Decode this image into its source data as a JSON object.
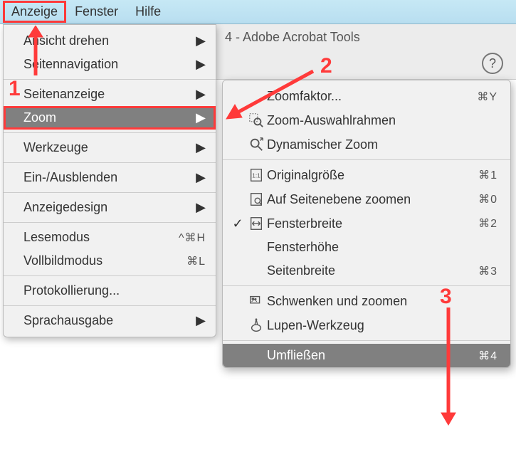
{
  "menubar": {
    "anzeige": "Anzeige",
    "fenster": "Fenster",
    "hilfe": "Hilfe"
  },
  "dropdown": {
    "ansicht_drehen": "Ansicht drehen",
    "seitennavigation": "Seitennavigation",
    "seitenanzeige": "Seitenanzeige",
    "zoom": "Zoom",
    "werkzeuge": "Werkzeuge",
    "ein_ausblenden": "Ein-/Ausblenden",
    "anzeigedesign": "Anzeigedesign",
    "lesemodus": "Lesemodus",
    "lesemodus_sc": "^⌘H",
    "vollbildmodus": "Vollbildmodus",
    "vollbildmodus_sc": "⌘L",
    "protokollierung": "Protokollierung...",
    "sprachausgabe": "Sprachausgabe"
  },
  "toolbar": {
    "title": "4 - Adobe Acrobat Tools",
    "help": "?"
  },
  "submenu": {
    "zoomfaktor": "Zoomfaktor...",
    "zoomfaktor_sc": "⌘Y",
    "zoom_auswahlrahmen": "Zoom-Auswahlrahmen",
    "dynamischer_zoom": "Dynamischer Zoom",
    "originalgroesse": "Originalgröße",
    "originalgroesse_sc": "⌘1",
    "auf_seitenebene": "Auf Seitenebene zoomen",
    "auf_seitenebene_sc": "⌘0",
    "fensterbreite": "Fensterbreite",
    "fensterbreite_sc": "⌘2",
    "fensterhoehe": "Fensterhöhe",
    "seitenbreite": "Seitenbreite",
    "seitenbreite_sc": "⌘3",
    "schwenken": "Schwenken und zoomen",
    "lupen": "Lupen-Werkzeug",
    "umfliessen": "Umfließen",
    "umfliessen_sc": "⌘4"
  },
  "annotations": {
    "n1": "1",
    "n2": "2",
    "n3": "3"
  },
  "glyphs": {
    "submenu_arrow": "▶",
    "check": "✓"
  }
}
